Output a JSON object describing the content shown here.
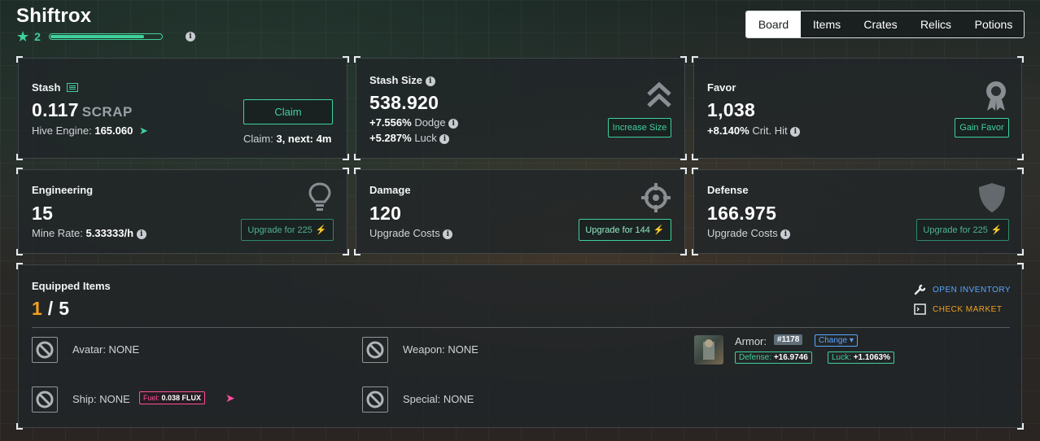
{
  "header": {
    "title": "Shiftrox",
    "level": "2",
    "xp_progress": 0.85
  },
  "tabs": [
    {
      "label": "Board",
      "active": true
    },
    {
      "label": "Items",
      "active": false
    },
    {
      "label": "Crates",
      "active": false
    },
    {
      "label": "Relics",
      "active": false
    },
    {
      "label": "Potions",
      "active": false
    }
  ],
  "stash": {
    "label": "Stash",
    "value": "0.117",
    "unit": "SCRAP",
    "hive_label": "Hive Engine:",
    "hive_value": "165.060",
    "claim_button": "Claim",
    "claim_info_label": "Claim:",
    "claim_info_value": "3, next: 4m"
  },
  "stash_size": {
    "label": "Stash Size",
    "value": "538.920",
    "dodge_value": "+7.556%",
    "dodge_label": "Dodge",
    "luck_value": "+5.287%",
    "luck_label": "Luck",
    "button": "Increase Size"
  },
  "favor": {
    "label": "Favor",
    "value": "1,038",
    "crit_value": "+8.140%",
    "crit_label": "Crit. Hit",
    "button": "Gain Favor"
  },
  "engineering": {
    "label": "Engineering",
    "value": "15",
    "mine_label": "Mine Rate:",
    "mine_value": "5.33333/h",
    "button": "Upgrade for 225"
  },
  "damage": {
    "label": "Damage",
    "value": "120",
    "sub": "Upgrade Costs",
    "button": "Upgrade for 144"
  },
  "defense": {
    "label": "Defense",
    "value": "166.975",
    "sub": "Upgrade Costs",
    "button": "Upgrade for 225"
  },
  "equipped": {
    "label": "Equipped Items",
    "count": "1",
    "separator": "/",
    "total": "5",
    "open_inventory": "OPEN INVENTORY",
    "check_market": "CHECK MARKET",
    "slots": {
      "avatar": "Avatar: NONE",
      "weapon": "Weapon: NONE",
      "ship": "Ship: NONE",
      "special": "Special: NONE"
    },
    "fuel_label": "Fuel:",
    "fuel_value": "0.038 FLUX",
    "armor_label": "Armor:",
    "armor_id": "#1178",
    "change_label": "Change",
    "defense_label": "Defense:",
    "defense_value": "+16.9746",
    "luck_label": "Luck:",
    "luck_value": "+1.1063%"
  },
  "colors": {
    "accent": "#3fd19b",
    "pink": "#ff4f9a",
    "blue": "#5aa7ff",
    "orange": "#f0a020"
  }
}
